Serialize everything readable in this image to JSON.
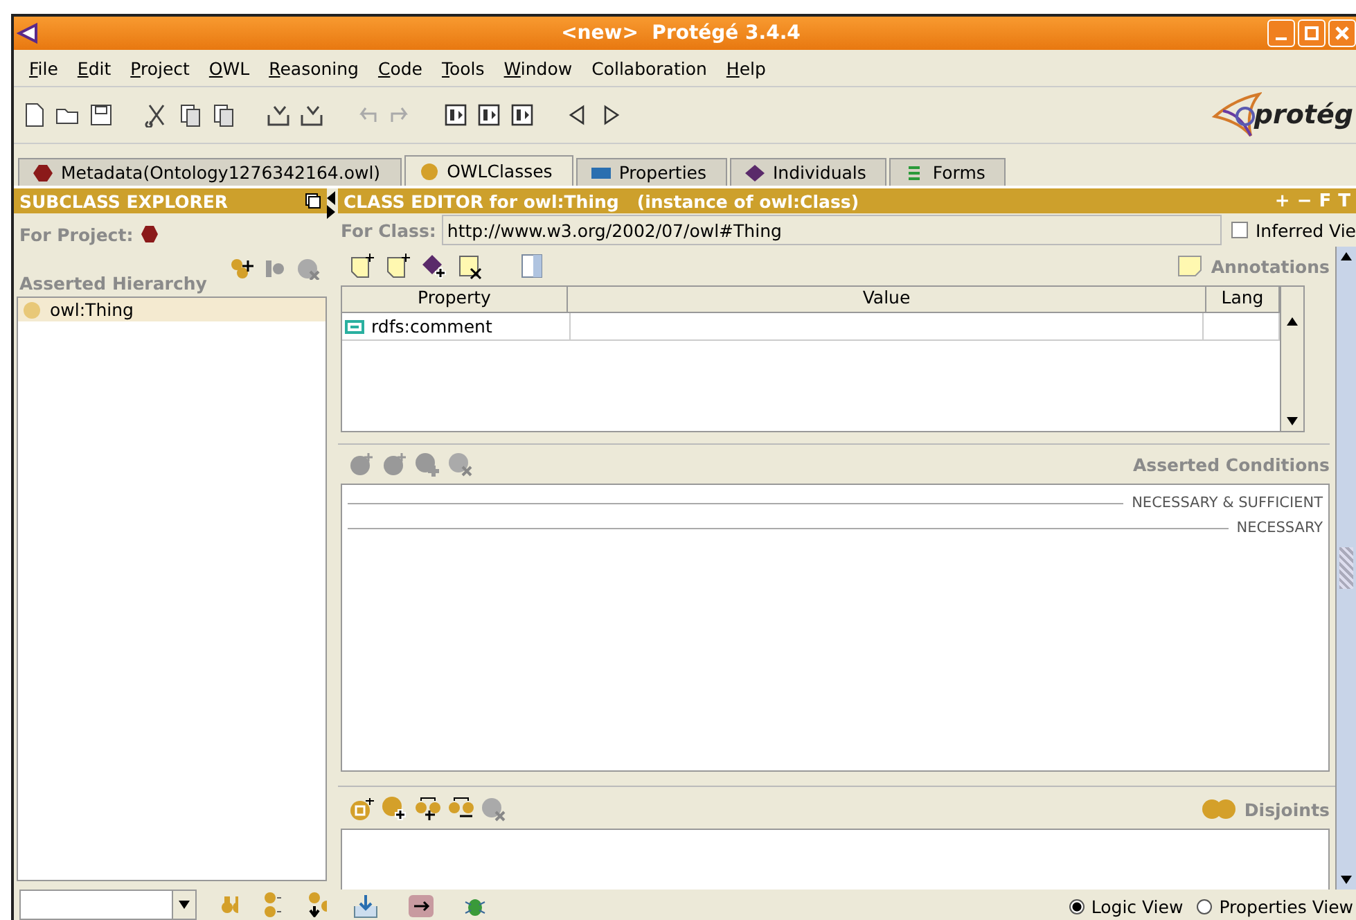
{
  "window": {
    "title": "<new>  Protégé 3.4.4"
  },
  "menu": [
    {
      "label": "File",
      "mnemonic": true
    },
    {
      "label": "Edit",
      "mnemonic": true
    },
    {
      "label": "Project",
      "mnemonic": true
    },
    {
      "label": "OWL",
      "mnemonic": true
    },
    {
      "label": "Reasoning",
      "mnemonic": true
    },
    {
      "label": "Code",
      "mnemonic": true
    },
    {
      "label": "Tools",
      "mnemonic": true
    },
    {
      "label": "Window",
      "mnemonic": true
    },
    {
      "label": "Collaboration",
      "mnemonic": false
    },
    {
      "label": "Help",
      "mnemonic": true
    }
  ],
  "logo": {
    "text": "protég"
  },
  "tabs": [
    {
      "label": "Metadata(Ontology1276342164.owl)",
      "kind": "metadata",
      "selected": false
    },
    {
      "label": "OWLClasses",
      "kind": "classes",
      "selected": true
    },
    {
      "label": "Properties",
      "kind": "properties",
      "selected": false
    },
    {
      "label": "Individuals",
      "kind": "individuals",
      "selected": false
    },
    {
      "label": "Forms",
      "kind": "forms",
      "selected": false
    }
  ],
  "subclass_explorer": {
    "title": "SUBCLASS EXPLORER",
    "for_project": "For Project:",
    "hierarchy_label": "Asserted Hierarchy",
    "tree": [
      {
        "label": "owl:Thing",
        "selected": true
      }
    ]
  },
  "class_editor": {
    "title": "CLASS EDITOR for owl:Thing   (instance of owl:Class)",
    "header_buttons": [
      "+",
      "−",
      "F",
      "T"
    ],
    "for_class_label": "For Class:",
    "for_class_value": "http://www.w3.org/2002/07/owl#Thing",
    "inferred_view": {
      "label": "Inferred Vie",
      "checked": false
    },
    "annotations_label": "Annotations",
    "columns": [
      "Property",
      "Value",
      "Lang"
    ],
    "rows": [
      {
        "property": "rdfs:comment"
      }
    ],
    "conditions_label": "Asserted Conditions",
    "condition_sections": [
      "NECESSARY & SUFFICIENT",
      "NECESSARY"
    ],
    "disjoints_label": "Disjoints"
  },
  "view_options": [
    {
      "label": "Logic View",
      "selected": true
    },
    {
      "label": "Properties View",
      "selected": false
    }
  ]
}
